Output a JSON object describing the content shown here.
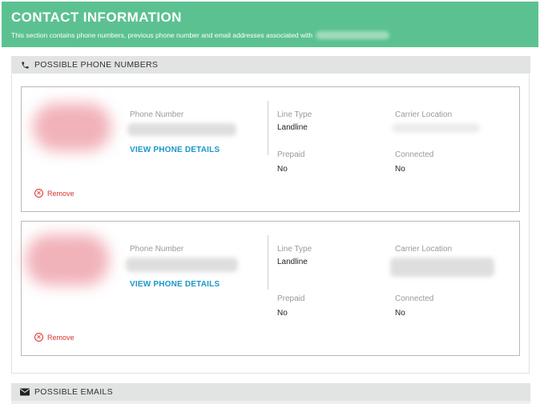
{
  "header": {
    "title": "CONTACT INFORMATION",
    "subtitle": "This section contains phone numbers, previous phone number and email addresses associated with"
  },
  "phone_section": {
    "title": "POSSIBLE PHONE NUMBERS",
    "icon": "phone-icon"
  },
  "email_section": {
    "title": "POSSIBLE EMAILS",
    "icon": "envelope-icon"
  },
  "phones": [
    {
      "phone_number_label": "Phone Number",
      "details_link": "VIEW PHONE DETAILS",
      "line_type_label": "Line Type",
      "line_type": "Landline",
      "carrier_location_label": "Carrier Location",
      "prepaid_label": "Prepaid",
      "prepaid": "No",
      "connected_label": "Connected",
      "connected": "No",
      "remove_label": "Remove"
    },
    {
      "phone_number_label": "Phone Number",
      "details_link": "VIEW PHONE DETAILS",
      "line_type_label": "Line Type",
      "line_type": "Landline",
      "carrier_location_label": "Carrier Location",
      "prepaid_label": "Prepaid",
      "prepaid": "No",
      "connected_label": "Connected",
      "connected": "No",
      "remove_label": "Remove"
    }
  ],
  "colors": {
    "header_bg": "#5cc191",
    "link": "#1a97c8",
    "remove": "#d9322b"
  }
}
